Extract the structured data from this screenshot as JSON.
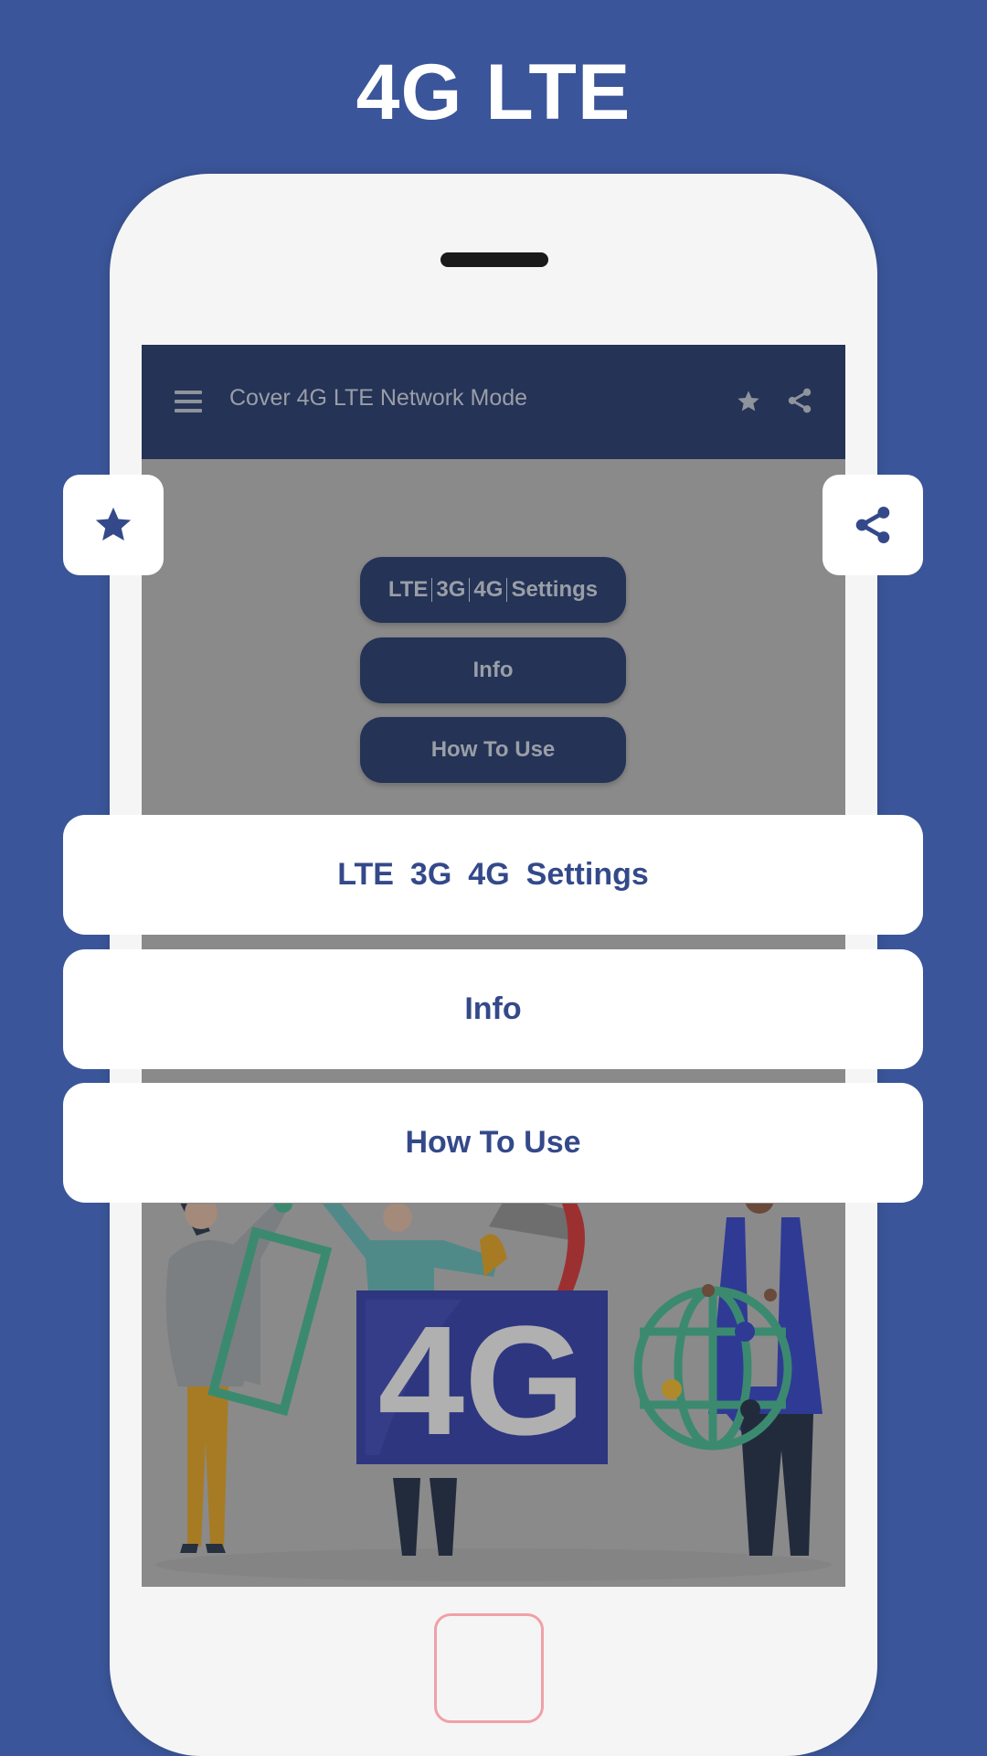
{
  "promo": {
    "title": "4G LTE"
  },
  "app": {
    "title": "Cover 4G LTE  Network Mode",
    "icons": {
      "menu": "hamburger-menu-icon",
      "favorite": "star-icon",
      "share": "share-icon"
    },
    "buttons": [
      {
        "parts": [
          "LTE",
          "3G",
          "4G",
          "Settings"
        ]
      },
      {
        "label": "Info"
      },
      {
        "label": "How To Use"
      }
    ],
    "illustration": {
      "badge_text": "4G"
    }
  },
  "overlay": {
    "favorite_icon": "star-icon",
    "share_icon": "share-icon",
    "buttons": [
      {
        "parts": [
          "LTE",
          "3G",
          "4G",
          "Settings"
        ]
      },
      {
        "label": "Info"
      },
      {
        "label": "How To Use"
      }
    ]
  },
  "colors": {
    "background": "#3a5599",
    "appbar": "#243356",
    "accent_text": "#34498a",
    "screen_dim": "#8a8a8a"
  }
}
